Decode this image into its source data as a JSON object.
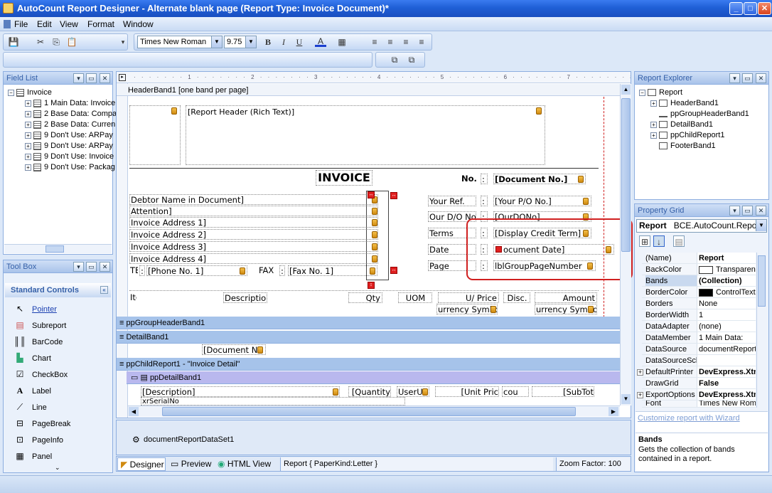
{
  "window": {
    "title": "AutoCount Report Designer - Alternate blank page (Report Type: Invoice Document)*"
  },
  "menu": [
    "File",
    "Edit",
    "View",
    "Format",
    "Window"
  ],
  "toolbar": {
    "font_family": "Times New Roman",
    "font_size": "9.75",
    "bold": "B",
    "italic": "I",
    "underline": "U",
    "font_color": "A"
  },
  "field_list": {
    "title": "Field List",
    "root": "Invoice",
    "items": [
      "1 Main Data:  Invoice",
      "2 Base Data:  Compa",
      "2 Base Data:  Curren",
      "9 Don't Use:  ARPay",
      "9 Don't Use:  ARPay",
      "9 Don't Use:  Invoice",
      "9 Don't Use:  Packag"
    ]
  },
  "toolbox": {
    "title": "Tool Box",
    "section": "Standard Controls",
    "items": [
      "Pointer",
      "Subreport",
      "BarCode",
      "Chart",
      "CheckBox",
      "Label",
      "Line",
      "PageBreak",
      "PageInfo",
      "Panel"
    ]
  },
  "designer": {
    "header_band": "HeaderBand1 [one band per page]",
    "report_header": "[Report Header (Rich Text)]",
    "invoice_title": "INVOICE",
    "no_label": "No.",
    "colon": ":",
    "doc_no": "[Document No.]",
    "debtor_name": "Debtor Name in Document]",
    "attention": "Attention]",
    "addr1": "Invoice Address 1]",
    "addr2": "Invoice Address 2]",
    "addr3": "Invoice Address 3]",
    "addr4": "Invoice Address 4]",
    "tel_label": "TEL",
    "phone": "[Phone No. 1]",
    "fax_label": "FAX",
    "fax": "[Fax No. 1]",
    "your_ref_label": "Your Ref.",
    "your_ref": "[Your P/O No.]",
    "our_do_label": "Our D/O No.",
    "our_do": "[OurDONo]",
    "terms_label": "Terms",
    "terms": "[Display Credit Term]",
    "date_label": "Date",
    "date": "ocument Date]",
    "page_label": "Page",
    "page": "lblGroupPageNumber",
    "col_item": "Item",
    "col_desc": "Description",
    "col_qty": "Qty",
    "col_uom": "UOM",
    "col_uprice": "U/ Price",
    "col_disc": "Disc.",
    "col_amount": "Amount",
    "currency1": "urrency Symbo",
    "currency2": "urrency Symbo",
    "group_header_band": "ppGroupHeaderBand1",
    "detail_band": "DetailBand1",
    "detail_doc_no": "[Document No",
    "child_report": "ppChildReport1 - \"Invoice Detail\"",
    "pp_detail_band": "ppDetailBand1",
    "d_desc": "[Description]",
    "d_qty": "[Quantity",
    "d_uom": "UserU",
    "d_unit_price": "[Unit Pric",
    "d_discount": "cou",
    "d_subtotal": "[SubTot",
    "d_serial": "xrSerialNo"
  },
  "dataset": "documentReportDataSet1",
  "bottom_tabs": {
    "designer": "Designer",
    "preview": "Preview",
    "html_view": "HTML View",
    "status": "Report { PaperKind:Letter }",
    "zoom": "Zoom Factor: 100"
  },
  "report_explorer": {
    "title": "Report Explorer",
    "root": "Report",
    "items": [
      "HeaderBand1",
      "ppGroupHeaderBand1",
      "DetailBand1",
      "ppChildReport1",
      "FooterBand1"
    ]
  },
  "property_grid": {
    "title": "Property Grid",
    "object_label": "Report",
    "object_value": "BCE.AutoCount.Report",
    "rows": [
      {
        "k": "(Name)",
        "v": "Report"
      },
      {
        "k": "BackColor",
        "v": "Transparent"
      },
      {
        "k": "Bands",
        "v": "(Collection)"
      },
      {
        "k": "BorderColor",
        "v": "ControlText"
      },
      {
        "k": "Borders",
        "v": "None"
      },
      {
        "k": "BorderWidth",
        "v": "1"
      },
      {
        "k": "DataAdapter",
        "v": "(none)"
      },
      {
        "k": "DataMember",
        "v": "1 Main Data:"
      },
      {
        "k": "DataSource",
        "v": "documentReportD"
      },
      {
        "k": "DataSourceSch",
        "v": ""
      },
      {
        "k": "DefaultPrinter",
        "v": "DevExpress.Xtr"
      },
      {
        "k": "DrawGrid",
        "v": "False"
      },
      {
        "k": "ExportOptions",
        "v": "DevExpress.Xtr"
      },
      {
        "k": "Font",
        "v": "Times New Roman"
      }
    ],
    "link": "Customize report with Wizard",
    "desc_title": "Bands",
    "desc_text": "Gets the collection of bands contained in a report."
  },
  "colors": {
    "title_bar": "#2a66dc",
    "band": "#a6c3ea",
    "highlight": "#d02020"
  }
}
